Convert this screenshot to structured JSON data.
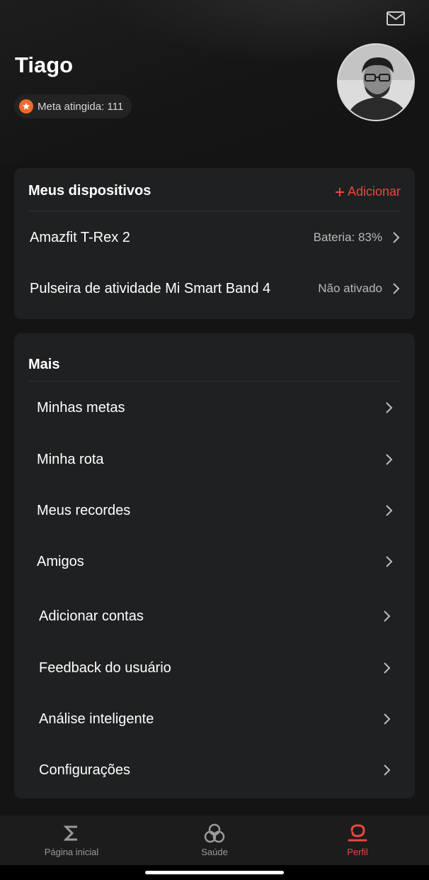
{
  "profile": {
    "name": "Tiago",
    "goal_text": "Meta atingida: 111"
  },
  "devices": {
    "title": "Meus dispositivos",
    "add_label": "Adicionar",
    "items": [
      {
        "name": "Amazfit T-Rex 2",
        "status": "Bateria: 83%"
      },
      {
        "name": "Pulseira de atividade Mi Smart Band 4",
        "status": "Não ativado"
      }
    ]
  },
  "more": {
    "title": "Mais",
    "items": [
      {
        "label": "Minhas metas"
      },
      {
        "label": "Minha rota"
      },
      {
        "label": "Meus recordes"
      },
      {
        "label": "Amigos"
      },
      {
        "label": "Adicionar contas"
      },
      {
        "label": "Feedback do usuário"
      },
      {
        "label": "Análise inteligente"
      },
      {
        "label": "Configurações"
      }
    ]
  },
  "nav": {
    "items": [
      {
        "label": "Página inicial",
        "icon": "sigma-icon",
        "active": false
      },
      {
        "label": "Saúde",
        "icon": "health-icon",
        "active": false
      },
      {
        "label": "Perfil",
        "icon": "profile-icon",
        "active": true
      }
    ]
  },
  "colors": {
    "accent": "#e9473f",
    "badge": "#f06a2a",
    "background": "#141414",
    "card": "#1f2021"
  }
}
